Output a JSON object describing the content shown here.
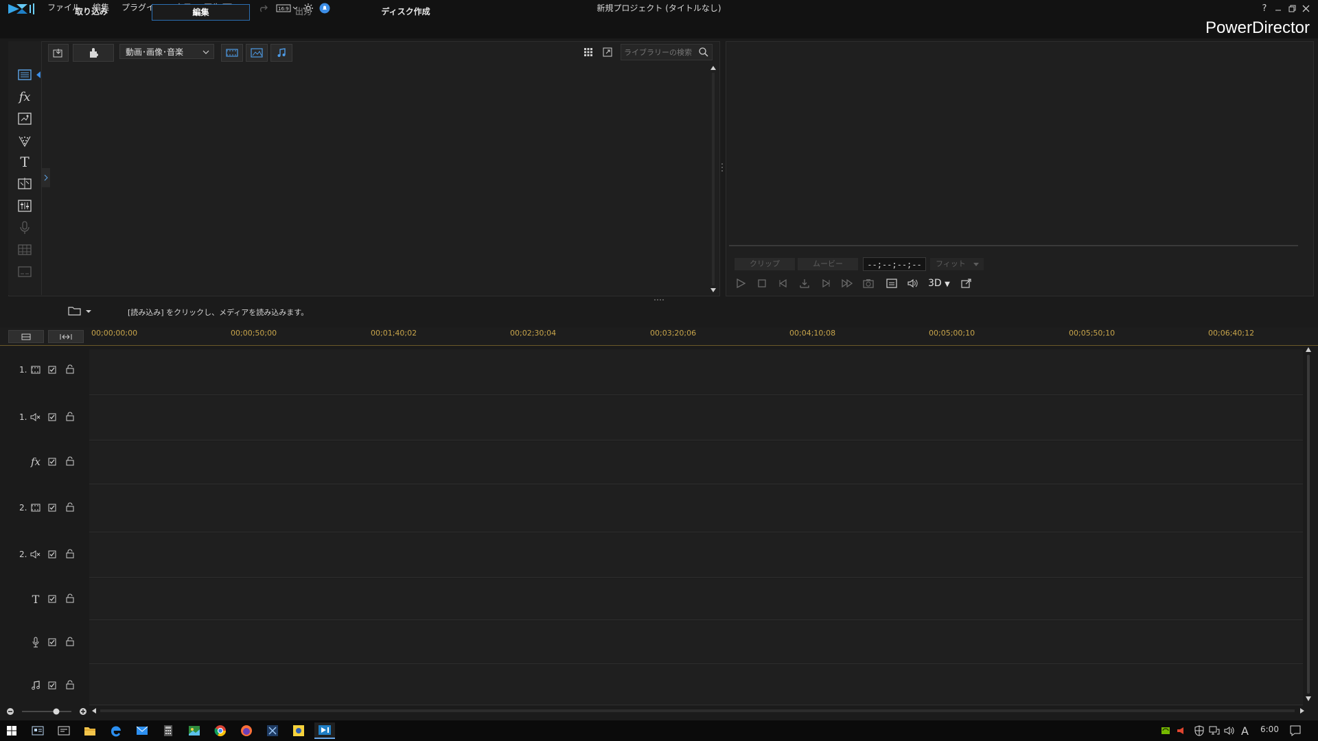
{
  "window": {
    "title": "新規プロジェクト (タイトルなし)",
    "brand": "PowerDirector",
    "menu": [
      "ファイル",
      "編集",
      "プラグイン",
      "表示",
      "再生"
    ],
    "aspect": "16:9"
  },
  "tabs": [
    {
      "label": "取り込み",
      "active": false
    },
    {
      "label": "編集",
      "active": true
    },
    {
      "label": "出力",
      "active": false
    },
    {
      "label": "ディスク作成",
      "active": false
    }
  ],
  "library": {
    "filter": "動画･画像･音楽",
    "search_placeholder": "ライブラリーの検索"
  },
  "preview": {
    "clip_label": "クリップ",
    "movie_label": "ムービー",
    "timecode": "--;--;--;--",
    "fit_label": "フィット",
    "three_d": "3D"
  },
  "status_message": "[読み込み] をクリックし、メディアを読み込みます。",
  "timeline": {
    "ticks": [
      "00;00;00;00",
      "00;00;50;00",
      "00;01;40;02",
      "00;02;30;04",
      "00;03;20;06",
      "00;04;10;08",
      "00;05;00;10",
      "00;05;50;10",
      "00;06;40;12"
    ],
    "tracks": [
      {
        "num": "1.",
        "icon": "video-track-icon"
      },
      {
        "num": "1.",
        "icon": "audio-track-icon"
      },
      {
        "num": "",
        "icon": "fx-track-icon"
      },
      {
        "num": "2.",
        "icon": "video-track-icon"
      },
      {
        "num": "2.",
        "icon": "audio-track-icon"
      },
      {
        "num": "",
        "icon": "title-track-icon"
      },
      {
        "num": "",
        "icon": "voice-track-icon"
      },
      {
        "num": "",
        "icon": "music-track-icon"
      }
    ]
  },
  "taskbar": {
    "clock": "6:00",
    "ime": "A"
  },
  "colors": {
    "accent": "#2b6fb3",
    "ruler_text": "#c8a54b",
    "background": "#1b1b1b"
  }
}
